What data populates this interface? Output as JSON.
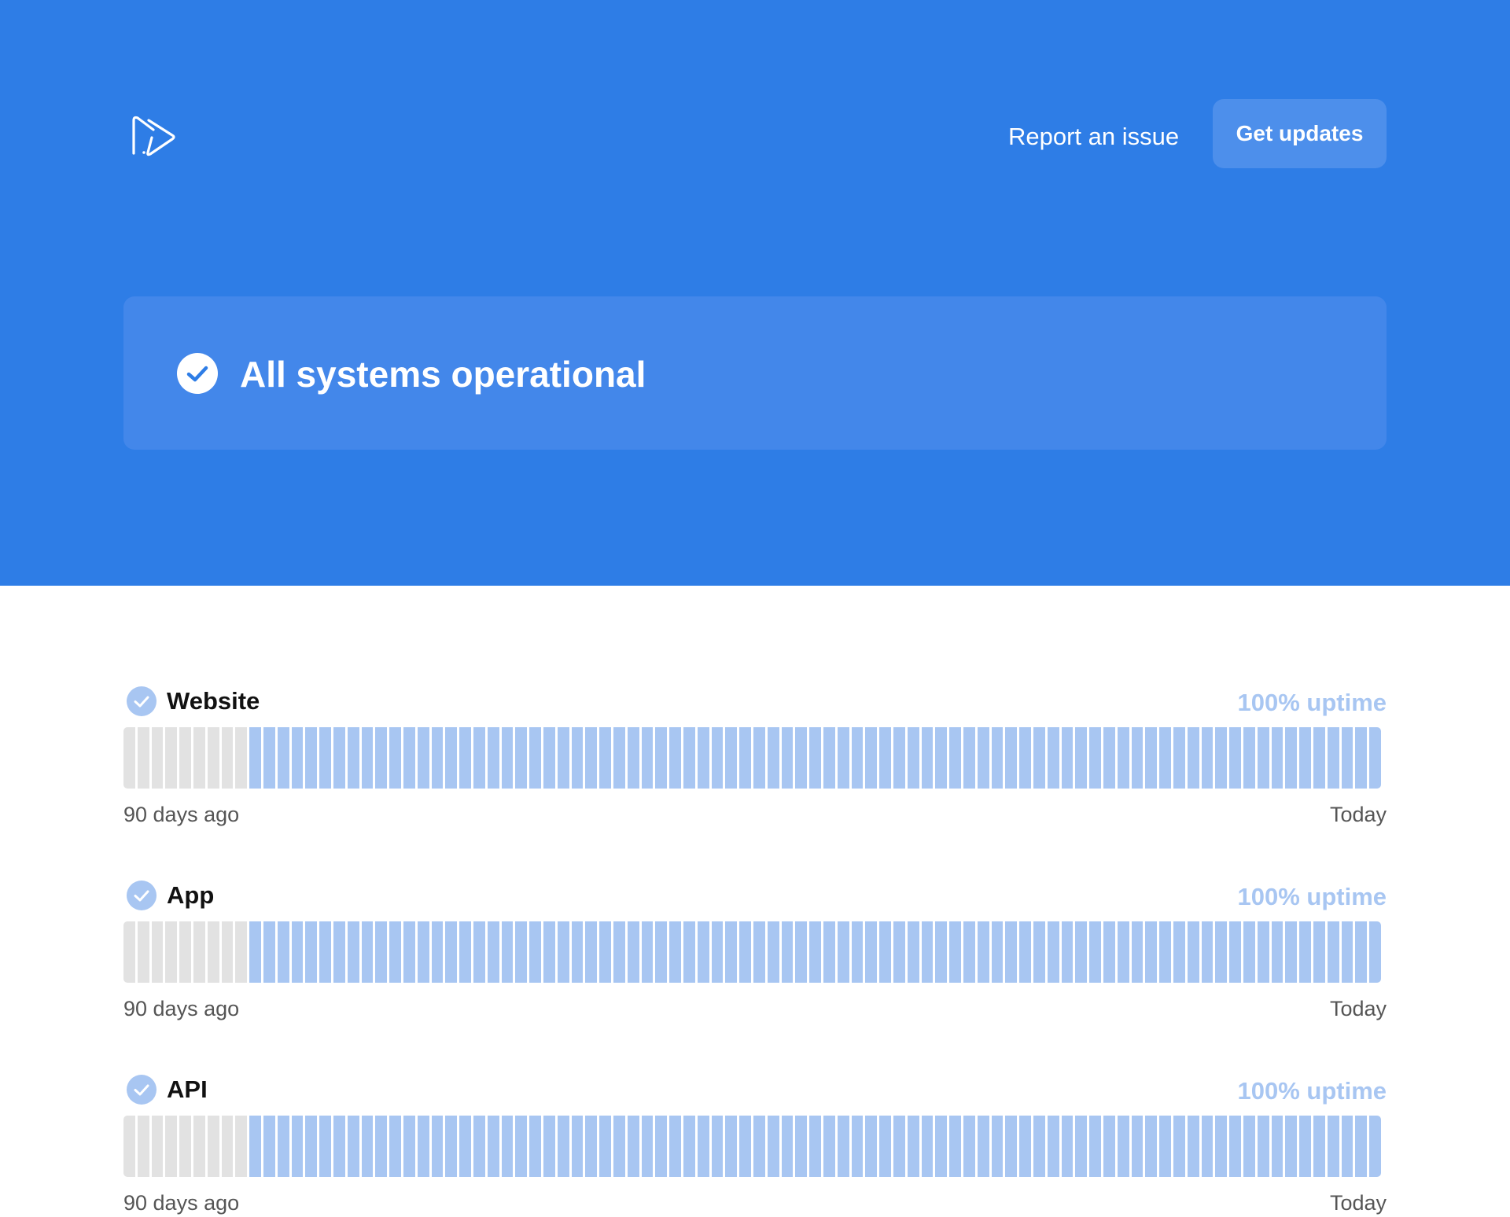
{
  "header": {
    "logo_icon": "double-play-logo-icon",
    "report_link": "Report an issue",
    "updates_button": "Get updates"
  },
  "status": {
    "icon": "check-circle-icon",
    "message": "All systems operational"
  },
  "colors": {
    "brand_blue": "#2E7DE6",
    "bar_up": "#A8C6F2",
    "bar_nodata": "#E2E2E2"
  },
  "components": [
    {
      "name": "Website",
      "uptime": "100% uptime",
      "start_label": "90 days ago",
      "end_label": "Today",
      "days_without_data": 9,
      "days_total": 90
    },
    {
      "name": "App",
      "uptime": "100% uptime",
      "start_label": "90 days ago",
      "end_label": "Today",
      "days_without_data": 9,
      "days_total": 90
    },
    {
      "name": "API",
      "uptime": "100% uptime",
      "start_label": "90 days ago",
      "end_label": "Today",
      "days_without_data": 9,
      "days_total": 90
    }
  ]
}
